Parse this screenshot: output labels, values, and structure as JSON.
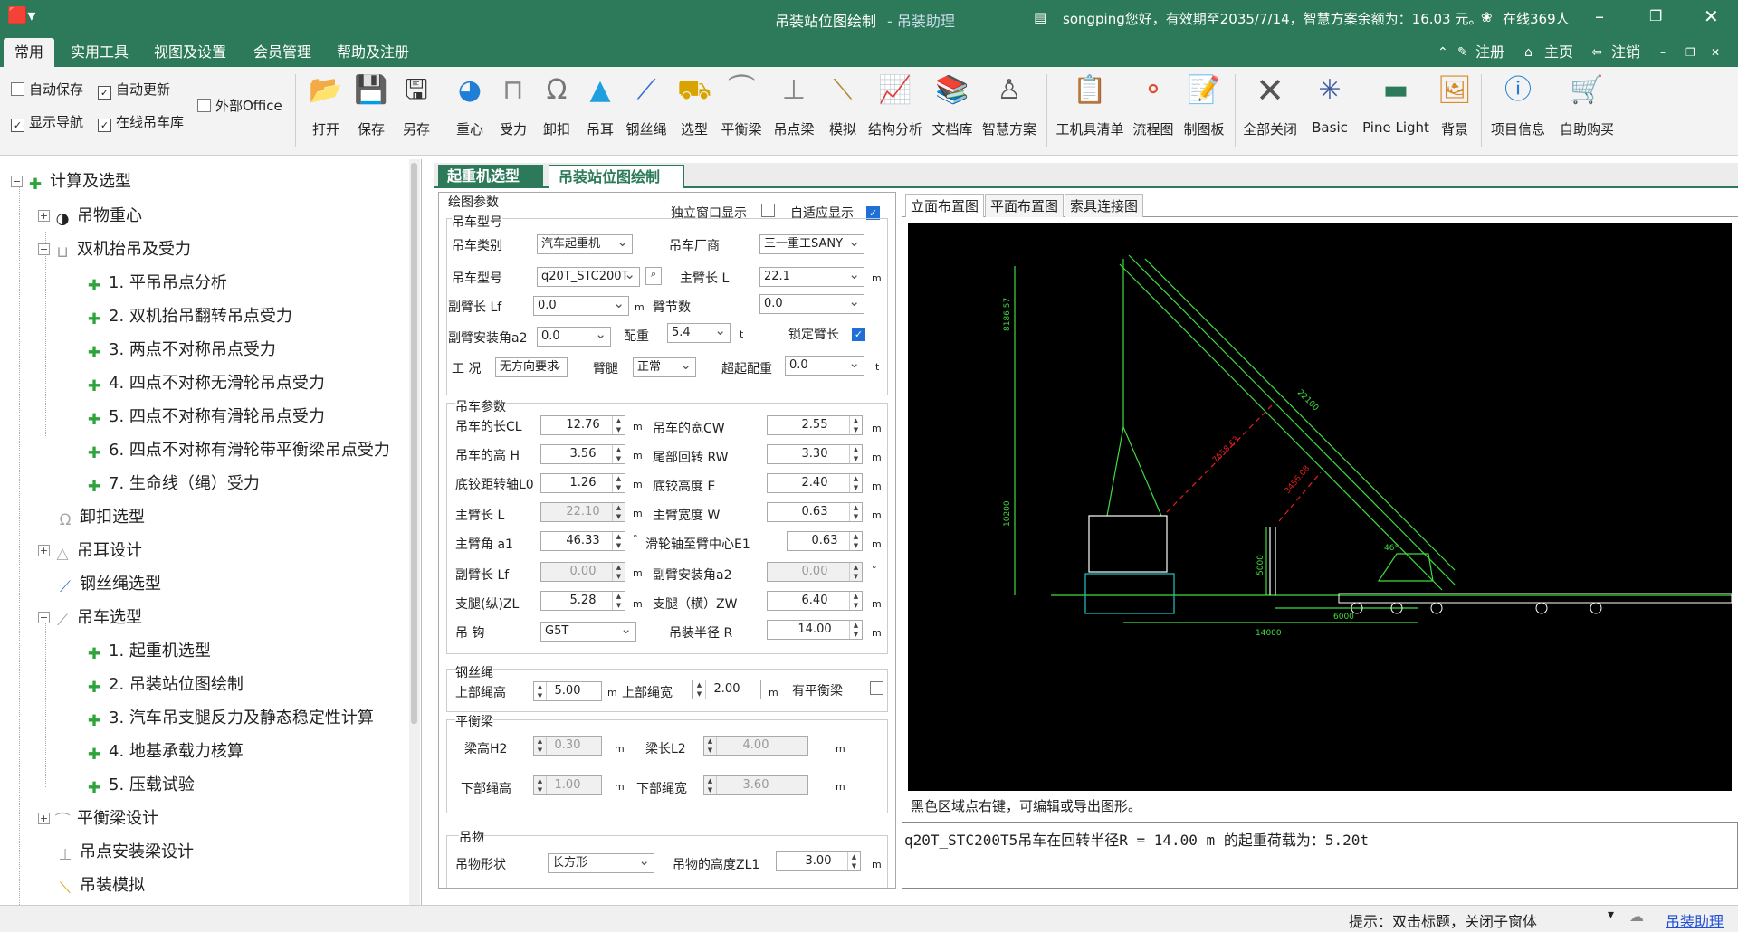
{
  "titlebar": {
    "title": "吊装站位图绘制",
    "app": "- 吊装助理",
    "user_info": "songping您好，有效期至2035/7/14，智慧方案余额为：16.03 元。",
    "online": "在线369人"
  },
  "ribbon_tabs": [
    "常用",
    "实用工具",
    "视图及设置",
    "会员管理",
    "帮助及注册"
  ],
  "top_links": {
    "register": "注册",
    "home": "主页",
    "logout": "注销"
  },
  "options": {
    "auto_save": "自动保存",
    "auto_update": "自动更新",
    "external_office": "外部Office",
    "show_nav": "显示导航",
    "online_crane_db": "在线吊车库"
  },
  "ribbon_buttons": {
    "open": "打开",
    "save": "保存",
    "save_as": "另存",
    "cg": "重心",
    "force": "受力",
    "shackle": "卸扣",
    "lug": "吊耳",
    "wire": "钢丝绳",
    "select": "选型",
    "balance": "平衡梁",
    "beam": "吊点梁",
    "sim": "模拟",
    "struct": "结构分析",
    "docs": "文档库",
    "smart": "智慧方案",
    "tools": "工机具清单",
    "flow": "流程图",
    "drawboard": "制图板",
    "close_all": "全部关闭",
    "basic": "Basic",
    "pine": "Pine Light",
    "bg": "背景",
    "project": "项目信息",
    "buy": "自助购买"
  },
  "tree": {
    "root": "计算及选型",
    "cg": "吊物重心",
    "dual": "双机抬吊及受力",
    "d1": "1. 平吊吊点分析",
    "d2": "2. 双机抬吊翻转吊点受力",
    "d3": "3. 两点不对称吊点受力",
    "d4": "4. 四点不对称无滑轮吊点受力",
    "d5": "5. 四点不对称有滑轮吊点受力",
    "d6": "6. 四点不对称有滑轮带平衡梁吊点受力",
    "d7": "7. 生命线（绳）受力",
    "shackle": "卸扣选型",
    "lug": "吊耳设计",
    "wire": "钢丝绳选型",
    "crane": "吊车选型",
    "c1": "1. 起重机选型",
    "c2": "2. 吊装站位图绘制",
    "c3": "3. 汽车吊支腿反力及静态稳定性计算",
    "c4": "4. 地基承载力核算",
    "c5": "5. 压载试验",
    "balance": "平衡梁设计",
    "beam_install": "吊点安装梁设计",
    "sim": "吊装模拟"
  },
  "doc_tabs": [
    "起重机选型",
    "吊装站位图绘制"
  ],
  "form": {
    "draw_params": "绘图参数",
    "independent": "独立窗口显示",
    "adaptive": "自适应显示",
    "crane_model_group": "吊车型号",
    "crane_type_label": "吊车类别",
    "crane_type": "汽车起重机",
    "maker_label": "吊车厂商",
    "maker": "三一重工SANY",
    "model_label": "吊车型号",
    "model": "q20T_STC200T",
    "main_boom_label": "主臂长  L",
    "main_boom": "22.1",
    "jib_label": "副臂长 Lf",
    "jib": "0.0",
    "jib_sections_label": "臂节数",
    "jib_sections": "0.0",
    "jib_angle_label": "副臂安装角a2",
    "jib_angle": "0.0",
    "counterweight_label": "配重",
    "counterweight": "5.4",
    "lock_boom": "锁定臂长",
    "condition_label": "工 况",
    "condition": "无方向要求",
    "outrigger_label": "臂腿",
    "outrigger": "正常",
    "super_cw_label": "超起配重",
    "super_cw": "0.0",
    "crane_params": "吊车参数",
    "cl_label": "吊车的长CL",
    "cl": "12.76",
    "cw_label": "吊车的宽CW",
    "cw": "2.55",
    "h_label": "吊车的高 H",
    "h": "3.56",
    "rw_label": "尾部回转 RW",
    "rw": "3.30",
    "l0_label": "底铰距转轴L0",
    "l0": "1.26",
    "e_label": "底铰高度 E",
    "e": "2.40",
    "l_label": "主臂长  L",
    "l": "22.10",
    "w_label": "主臂宽度 W",
    "w": "0.63",
    "a1_label": "主臂角  a1",
    "a1": "46.33",
    "e1_label": "滑轮轴至臂中心E1",
    "e1": "0.63",
    "lf_label": "副臂长 Lf",
    "lf": "0.00",
    "a2_label": "副臂安装角a2",
    "a2": "0.00",
    "zl_label": "支腿(纵)ZL",
    "zl": "5.28",
    "zw_label": "支腿（横）ZW",
    "zw": "6.40",
    "hook_label": "吊 钩",
    "hook": "G5T",
    "r_label": "吊装半径  R",
    "r": "14.00",
    "wire_group": "钢丝绳",
    "upper_h_label": "上部绳高",
    "upper_h": "5.00",
    "upper_w_label": "上部绳宽",
    "upper_w": "2.00",
    "has_beam": "有平衡梁",
    "beam_group": "平衡梁",
    "h2_label": "梁高H2",
    "h2": "0.30",
    "l2_label": "梁长L2",
    "l2": "4.00",
    "lower_h_label": "下部绳高",
    "lower_h": "1.00",
    "lower_w_label": "下部绳宽",
    "lower_w": "3.60",
    "obj_group": "吊物",
    "shape_label": "吊物形状",
    "shape": "长方形",
    "zl1_label": "吊物的高度ZL1",
    "zl1": "3.00",
    "unit_m": "m",
    "unit_t": "t",
    "unit_deg": "°"
  },
  "view_tabs": [
    "立面布置图",
    "平面布置图",
    "索具连接图"
  ],
  "drawing": {
    "dim_top": "8186.57",
    "dim_left": "10200",
    "dim_boom": "22100",
    "dim_r1": "7658.63",
    "dim_r2": "3456.08",
    "dim_5000": "5000",
    "dim_6000": "6000",
    "dim_14000": "14000",
    "angle": "46°"
  },
  "view_hint": "黑色区域点右键，可编辑或导出图形。",
  "result": "q20T_STC200T5吊车在回转半径R = 14.00 m 的起重荷载为：5.20t",
  "status": {
    "hint": "提示：双击标题，关闭子窗体",
    "app_link": "吊装助理"
  },
  "colors": {
    "titlebar": "#2d7a5a",
    "drawing_bg": "#000000",
    "line_green": "#3fdc3f",
    "line_red": "#e02020",
    "line_cyan": "#21c4c4"
  }
}
